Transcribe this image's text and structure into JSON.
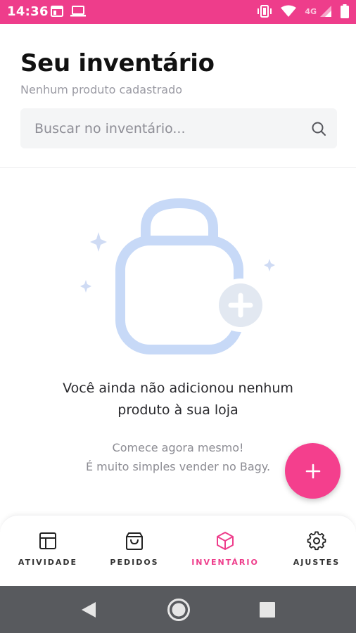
{
  "status_bar": {
    "time": "14:36",
    "network": "4G",
    "color": "#ee3d8b"
  },
  "header": {
    "title": "Seu inventário",
    "subtitle": "Nenhum produto cadastrado"
  },
  "search": {
    "placeholder": "Buscar no inventário..."
  },
  "empty_state": {
    "heading_line1": "Você ainda não adicionou nenhum",
    "heading_line2": "produto à sua loja",
    "text_line1": "Comece agora mesmo!",
    "text_line2": "É muito simples vender no Bagy."
  },
  "fab": {
    "label": "+",
    "color": "#f43f8d"
  },
  "bottom_nav": {
    "items": [
      {
        "label": "ATIVIDADE",
        "icon": "layout-icon"
      },
      {
        "label": "PEDIDOS",
        "icon": "shopping-bag-icon"
      },
      {
        "label": "INVENTÁRIO",
        "icon": "box-icon",
        "active": true
      },
      {
        "label": "AJUSTES",
        "icon": "gear-icon"
      }
    ],
    "active_color": "#ee3d8b"
  },
  "system_nav": {
    "buttons": [
      "back-icon",
      "home-icon",
      "recent-apps-icon"
    ]
  }
}
